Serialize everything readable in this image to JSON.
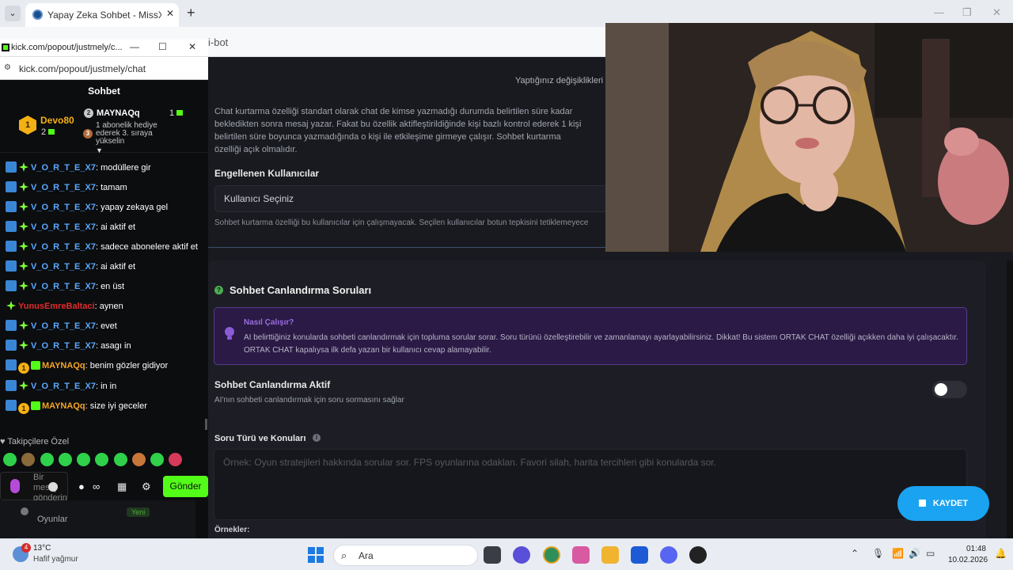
{
  "browser": {
    "tab_title": "Yapay Zeka Sohbet - MissXss AI",
    "partial_url": "i-bot"
  },
  "dashboard": {
    "saved_note": "Yaptığınız değişiklikleri",
    "revive_desc": "Chat kurtarma özelliği standart olarak chat de kimse yazmadığı durumda belirtilen süre kadar bekledikten sonra mesaj yazar. Fakat bu özellik aktifleştirildiğinde kişi bazlı kontrol ederek 1 kişi belirtilen süre boyunca yazmadığında o kişi ile etkileşime girmeye çalışır. Sohbet kurtarma özelliği açık olmalıdır.",
    "blocked_label": "Engellenen Kullanıcılar",
    "select_placeholder": "Kullanıcı Seçiniz",
    "blocked_help": "Sohbet kurtarma özelliği bu kullanıcılar için çalışmayacak. Seçilen kullanıcılar botun tepkisini tetiklemeyece",
    "section_title": "Sohbet Canlandırma Soruları",
    "info_heading": "Nasıl Çalışır?",
    "info_text": "AI belirttiğiniz konularda sohbeti canlandırmak için topluma sorular sorar. Soru türünü özelleştirebilir ve zamanlamayı ayarlayabilirsiniz. Dikkat! Bu sistem ORTAK CHAT özelliği açıkken daha iyi çalışacaktır. ORTAK CHAT kapalıysa ilk defa yazan bir kullanıcı cevap alamayabilir.",
    "toggle_title": "Sohbet Canlandırma Aktif",
    "toggle_desc": "AI'nın sohbeti canlandırmak için soru sormasını sağlar",
    "toggle_on": false,
    "question_type_label": "Soru Türü ve Konuları",
    "textarea_placeholder": "Örnek: Oyun stratejileri hakkında sorular sor. FPS oyunlarına odaklan. Favori silah, harita tercihleri gibi konularda sor.",
    "examples_label": "Örnekler:",
    "save_button": "KAYDET"
  },
  "popout": {
    "window_title": "kick.com/popout/justmely/c...",
    "url": "kick.com/popout/justmely/chat",
    "chat_title": "Sohbet",
    "leaderboard": {
      "first": {
        "rank": "1",
        "name": "Devo80",
        "count": "2"
      },
      "second": {
        "rank": "2",
        "name": "MAYNAQq",
        "count": "1"
      },
      "third": {
        "rank": "3",
        "text": "1 abonelik hediye ederek 3. sıraya yükselin"
      }
    },
    "messages": [
      {
        "badges": [
          "mod",
          "vip"
        ],
        "user": "V_O_R_T_E_X7",
        "color": "blue",
        "text": "modüllere gir"
      },
      {
        "badges": [
          "mod",
          "vip"
        ],
        "user": "V_O_R_T_E_X7",
        "color": "blue",
        "text": "tamam"
      },
      {
        "badges": [
          "mod",
          "vip"
        ],
        "user": "V_O_R_T_E_X7",
        "color": "blue",
        "text": "yapay zekaya gel"
      },
      {
        "badges": [
          "mod",
          "vip"
        ],
        "user": "V_O_R_T_E_X7",
        "color": "blue",
        "text": "ai aktif et"
      },
      {
        "badges": [
          "mod",
          "vip"
        ],
        "user": "V_O_R_T_E_X7",
        "color": "blue",
        "text": "sadece abonelere aktif et"
      },
      {
        "badges": [
          "mod",
          "vip"
        ],
        "user": "V_O_R_T_E_X7",
        "color": "blue",
        "text": "ai aktif et"
      },
      {
        "badges": [
          "mod",
          "vip"
        ],
        "user": "V_O_R_T_E_X7",
        "color": "blue",
        "text": "en üst"
      },
      {
        "badges": [
          "vip"
        ],
        "user": "YunusEmreBaltaci",
        "color": "red",
        "text": "aynen"
      },
      {
        "badges": [
          "mod",
          "vip"
        ],
        "user": "V_O_R_T_E_X7",
        "color": "blue",
        "text": "evet"
      },
      {
        "badges": [
          "mod",
          "vip"
        ],
        "user": "V_O_R_T_E_X7",
        "color": "blue",
        "text": "asagı in"
      },
      {
        "badges": [
          "mod",
          "top1",
          "gift"
        ],
        "user": "MAYNAQq",
        "color": "orange",
        "text": "benim gözler gidiyor"
      },
      {
        "badges": [
          "mod",
          "vip"
        ],
        "user": "V_O_R_T_E_X7",
        "color": "blue",
        "text": "in in"
      },
      {
        "badges": [
          "mod",
          "top1",
          "gift"
        ],
        "user": "MAYNAQq",
        "color": "orange",
        "text": "size iyi geceler"
      }
    ],
    "followers_label": "♥ Takipçilere Özel",
    "input_placeholder": "Bir mesaj gönderin",
    "send_button": "Gönder",
    "under_item": "Oyunlar",
    "under_badge": "Yeni"
  },
  "taskbar": {
    "weather_badge": "4",
    "temperature": "13°C",
    "weather_desc": "Hafif yağmur",
    "search_label": "Ara",
    "time": "01:48",
    "date": "10.02.2026"
  }
}
